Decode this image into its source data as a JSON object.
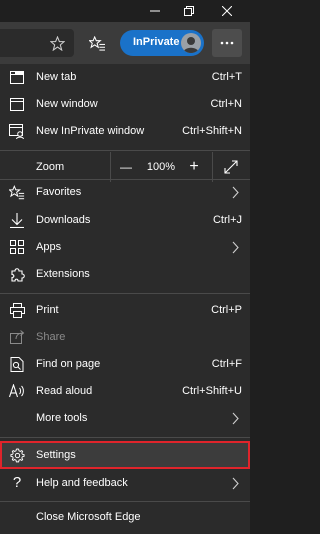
{
  "window_controls": {
    "icons": [
      "minimize-icon",
      "restore-icon",
      "close-icon"
    ]
  },
  "toolbar": {
    "inprivate_label": "InPrivate",
    "icons": [
      "star-icon",
      "favorites-icon",
      "avatar-icon",
      "more-icon"
    ]
  },
  "menu": {
    "new_tab": {
      "label": "New tab",
      "shortcut": "Ctrl+T"
    },
    "new_window": {
      "label": "New window",
      "shortcut": "Ctrl+N"
    },
    "new_inprivate": {
      "label": "New InPrivate window",
      "shortcut": "Ctrl+Shift+N"
    },
    "zoom": {
      "label": "Zoom",
      "minus": "—",
      "value": "100%",
      "plus": "+"
    },
    "favorites": {
      "label": "Favorites"
    },
    "downloads": {
      "label": "Downloads",
      "shortcut": "Ctrl+J"
    },
    "apps": {
      "label": "Apps"
    },
    "extensions": {
      "label": "Extensions"
    },
    "print": {
      "label": "Print",
      "shortcut": "Ctrl+P"
    },
    "share": {
      "label": "Share"
    },
    "find_on_page": {
      "label": "Find on page",
      "shortcut": "Ctrl+F"
    },
    "read_aloud": {
      "label": "Read aloud",
      "shortcut": "Ctrl+Shift+U"
    },
    "more_tools": {
      "label": "More tools"
    },
    "settings": {
      "label": "Settings"
    },
    "help": {
      "label": "Help and feedback"
    },
    "close_edge": {
      "label": "Close Microsoft Edge"
    }
  },
  "colors": {
    "accent": "#1a72c9",
    "highlight_border": "#e0242b",
    "menu_bg": "#2b2b2b",
    "toolbar_bg": "#3b3b3b"
  }
}
